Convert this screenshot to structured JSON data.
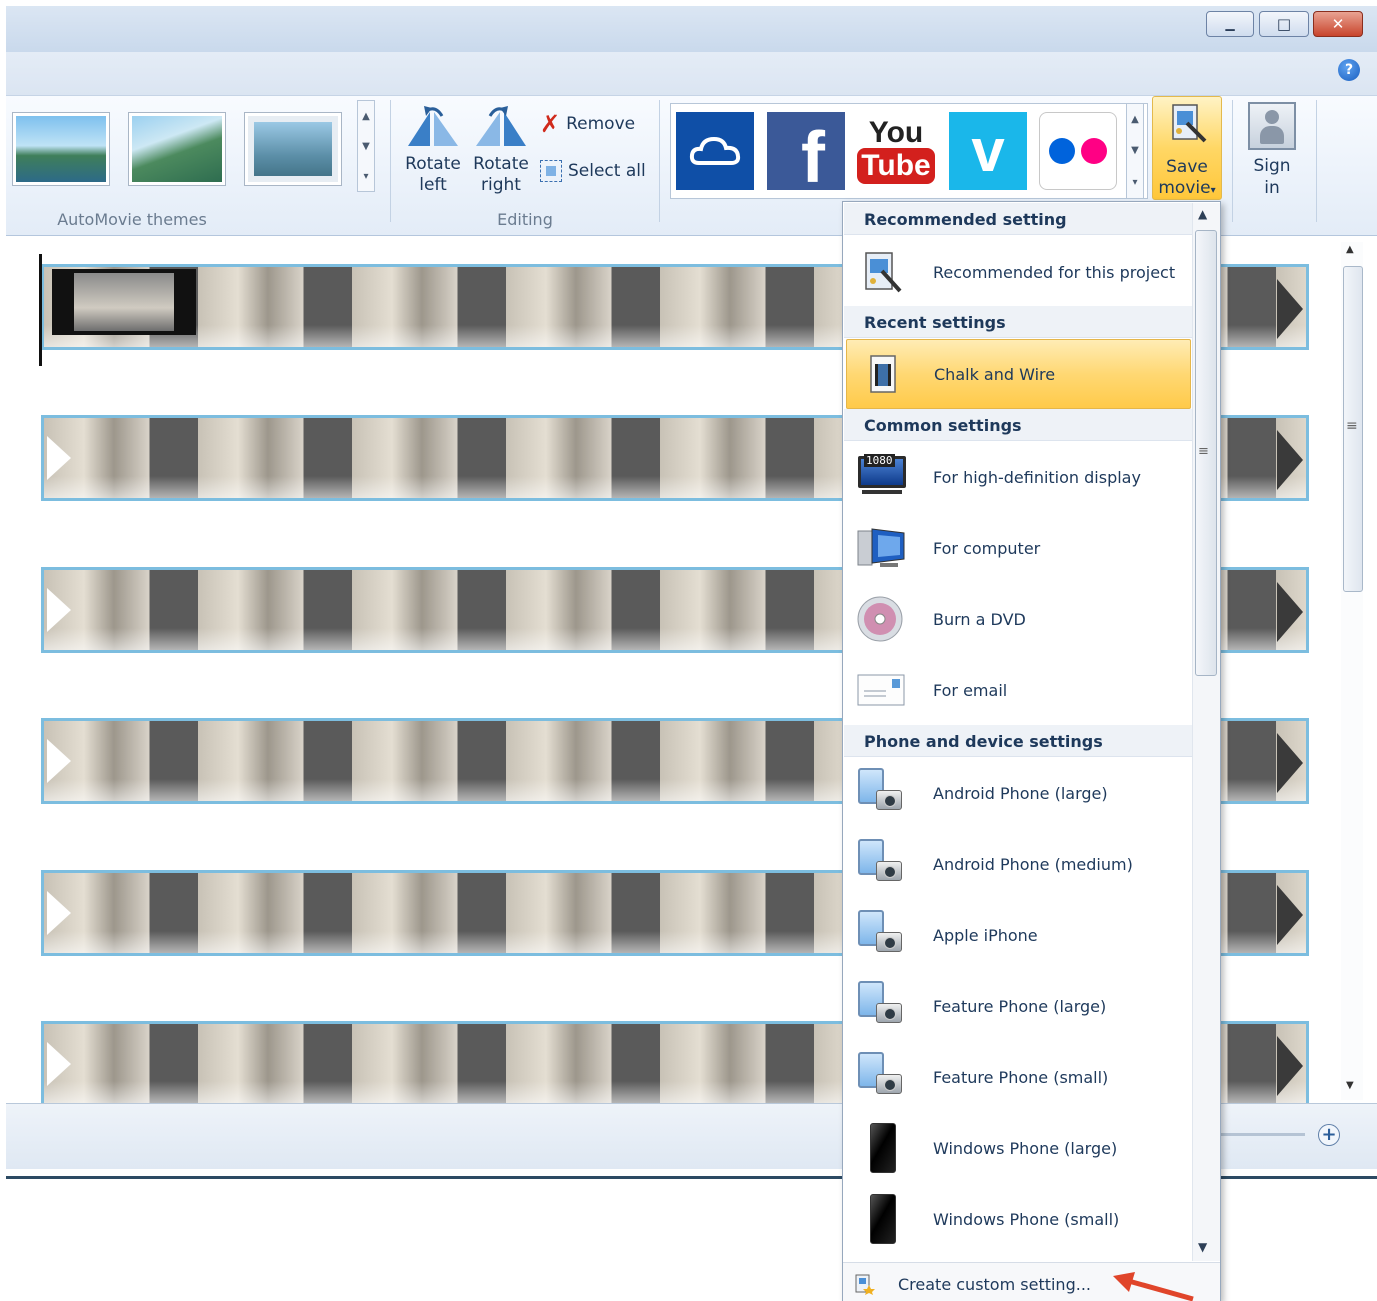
{
  "ribbon": {
    "themes_group_label": "AutoMovie themes",
    "editing_group_label": "Editing",
    "rotate_left_line1": "Rotate",
    "rotate_left_line2": "left",
    "rotate_right_line1": "Rotate",
    "rotate_right_line2": "right",
    "remove_label": "Remove",
    "select_all_label": "Select all",
    "save_movie_line1": "Save",
    "save_movie_line2": "movie",
    "sign_in_line1": "Sign",
    "sign_in_line2": "in",
    "share_services": [
      "onedrive",
      "facebook",
      "youtube",
      "vimeo",
      "flickr"
    ],
    "youtube_text_top": "You",
    "youtube_text_bottom": "Tube",
    "facebook_text": "f",
    "vimeo_text": "v"
  },
  "window": {
    "minimize_glyph": "▁",
    "maximize_glyph": "□",
    "close_glyph": "✕",
    "help_glyph": "?"
  },
  "statusbar": {
    "zoom_in_glyph": "+"
  },
  "save_menu": {
    "headers": {
      "recommended": "Recommended setting",
      "recent": "Recent settings",
      "common": "Common settings",
      "phone": "Phone and device settings"
    },
    "items": {
      "recommended_project": "Recommended for this project",
      "chalk_and_wire": "Chalk and Wire",
      "hd_display": "For high-definition display",
      "computer": "For computer",
      "burn_dvd": "Burn a DVD",
      "email": "For email",
      "android_large": "Android Phone (large)",
      "android_medium": "Android Phone (medium)",
      "apple_iphone": "Apple iPhone",
      "feature_large": "Feature Phone (large)",
      "feature_small": "Feature Phone (small)",
      "windows_large": "Windows Phone (large)",
      "windows_small": "Windows Phone (small)"
    },
    "hd_badge": "1080",
    "footer_item": "Create custom setting..."
  },
  "colors": {
    "highlight": "#ffd873",
    "clip_border": "#7cbddf",
    "annotation_arrow": "#e0452a",
    "onedrive_bg": "#0f4fa7",
    "facebook_bg": "#3b5998",
    "youtube_red": "#d3201d",
    "vimeo_bg": "#1ab7ea",
    "flickr_blue": "#0063dc",
    "flickr_pink": "#ff0084"
  }
}
